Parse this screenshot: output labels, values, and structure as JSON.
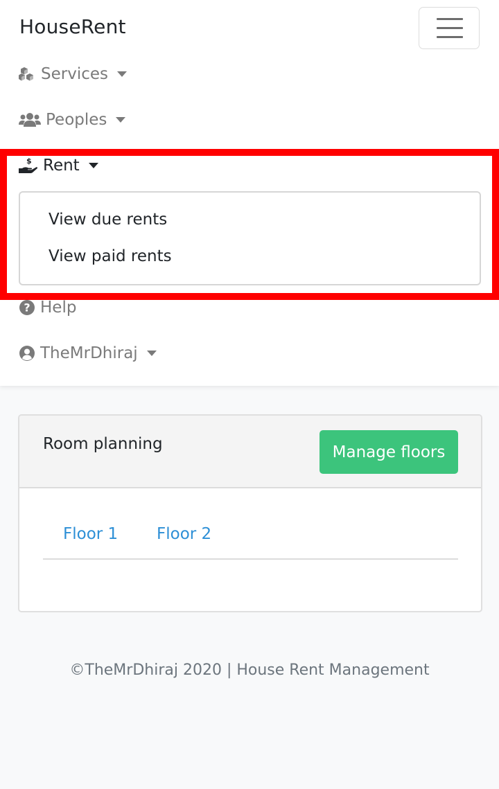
{
  "navbar": {
    "brand": "HouseRent",
    "toggler_icon": "hamburger-icon",
    "items": [
      {
        "label": "Services",
        "icon": "cubes-icon",
        "has_caret": true
      },
      {
        "label": "Peoples",
        "icon": "users-icon",
        "has_caret": true
      },
      {
        "label": "Rent",
        "icon": "hand-holding-usd-icon",
        "has_caret": true,
        "expanded": true
      },
      {
        "label": "Help",
        "icon": "question-circle-icon",
        "has_caret": false
      },
      {
        "label": "TheMrDhiraj",
        "icon": "user-circle-icon",
        "has_caret": true
      }
    ],
    "rent_dropdown": [
      "View due rents",
      "View paid rents"
    ]
  },
  "card": {
    "title": "Room planning",
    "button_label": "Manage floors",
    "tabs": [
      "Floor 1",
      "Floor 2"
    ]
  },
  "footer": {
    "text": "©TheMrDhiraj 2020 | House Rent Management"
  },
  "colors": {
    "accent_green": "#3cc47c",
    "link_blue": "#2d8fd6",
    "highlight_red": "#ff0000",
    "nav_gray": "#7a7a7a"
  }
}
